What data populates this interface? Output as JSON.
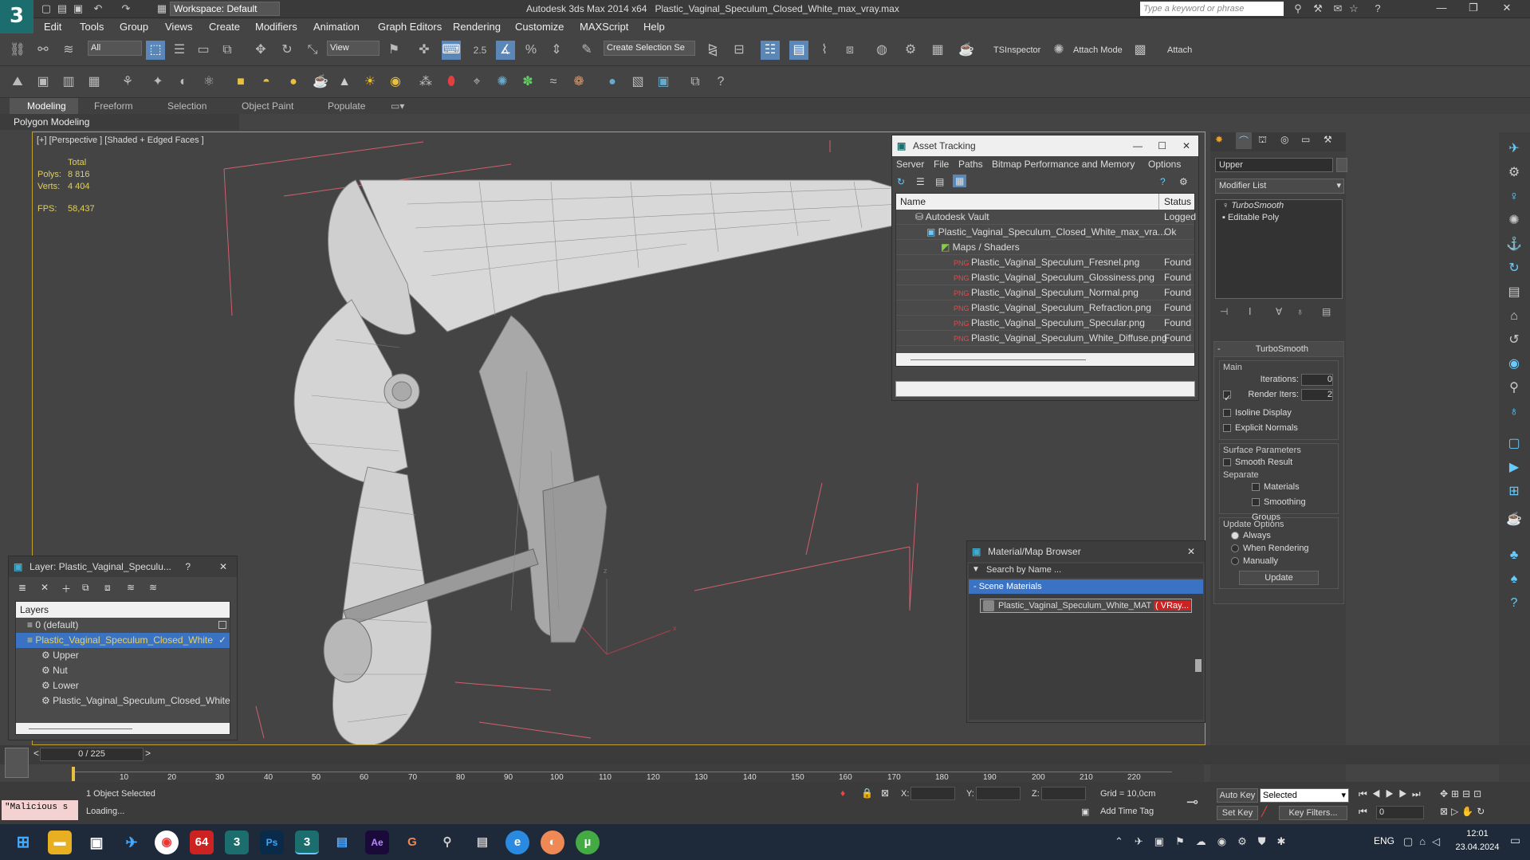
{
  "app": {
    "title": "Autodesk 3ds Max 2014 x64",
    "file": "Plastic_Vaginal_Speculum_Closed_White_max_vray.max",
    "workspace": "Workspace: Default",
    "search_placeholder": "Type a keyword or phrase"
  },
  "menu": [
    "Edit",
    "Tools",
    "Group",
    "Views",
    "Create",
    "Modifiers",
    "Animation",
    "Graph Editors",
    "Rendering",
    "Customize",
    "MAXScript",
    "Help"
  ],
  "toolbar": {
    "filter": "All",
    "refcoord": "View",
    "spinner": "2.5",
    "selection_set": "Create Selection Se",
    "tsinspector": "TSInspector",
    "attach_mode": "Attach Mode",
    "attach": "Attach"
  },
  "ribbon": {
    "tabs": [
      "Modeling",
      "Freeform",
      "Selection",
      "Object Paint",
      "Populate"
    ],
    "sub": "Polygon Modeling"
  },
  "viewport": {
    "label": "[+] [Perspective ] [Shaded + Edged Faces ]",
    "total_label": "Total",
    "polys_label": "Polys:",
    "polys": "8 816",
    "verts_label": "Verts:",
    "verts": "4 404",
    "fps_label": "FPS:",
    "fps": "58,437",
    "axis_z": "z",
    "axis_x": "x"
  },
  "asset_tracking": {
    "title": "Asset Tracking",
    "menu": [
      "Server",
      "File",
      "Paths",
      "Bitmap Performance and Memory",
      "Options"
    ],
    "col_name": "Name",
    "col_status": "Status",
    "rows": [
      {
        "name": "Autodesk Vault",
        "status": "Logged"
      },
      {
        "name": "Plastic_Vaginal_Speculum_Closed_White_max_vra...",
        "status": "Ok"
      },
      {
        "name": "Maps / Shaders",
        "status": ""
      },
      {
        "name": "Plastic_Vaginal_Speculum_Fresnel.png",
        "status": "Found"
      },
      {
        "name": "Plastic_Vaginal_Speculum_Glossiness.png",
        "status": "Found"
      },
      {
        "name": "Plastic_Vaginal_Speculum_Normal.png",
        "status": "Found"
      },
      {
        "name": "Plastic_Vaginal_Speculum_Refraction.png",
        "status": "Found"
      },
      {
        "name": "Plastic_Vaginal_Speculum_Specular.png",
        "status": "Found"
      },
      {
        "name": "Plastic_Vaginal_Speculum_White_Diffuse.png",
        "status": "Found"
      }
    ]
  },
  "layer": {
    "title": "Layer: Plastic_Vaginal_Speculu...",
    "help": "?",
    "header": "Layers",
    "items": [
      "0 (default)",
      "Plastic_Vaginal_Speculum_Closed_White",
      "Upper",
      "Nut",
      "Lower",
      "Plastic_Vaginal_Speculum_Closed_White"
    ]
  },
  "material": {
    "title": "Material/Map Browser",
    "search_placeholder": "Search by Name ...",
    "group": "- Scene Materials",
    "item": "Plastic_Vaginal_Speculum_White_MAT",
    "item_tag": "( VRay..."
  },
  "command": {
    "object_name": "Upper",
    "modifier_list": "Modifier List",
    "stack": [
      "TurboSmooth",
      "Editable Poly"
    ],
    "rollout": "TurboSmooth",
    "main": "Main",
    "iterations_label": "Iterations:",
    "iterations": "0",
    "render_iters_label": "Render Iters:",
    "render_iters": "2",
    "isoline": "Isoline Display",
    "explicit": "Explicit Normals",
    "surface": "Surface Parameters",
    "smooth_result": "Smooth Result",
    "separate": "Separate",
    "materials": "Materials",
    "smoothing_groups": "Smoothing Groups",
    "update_options": "Update Options",
    "always": "Always",
    "when_rendering": "When Rendering",
    "manually": "Manually",
    "update": "Update"
  },
  "timeline": {
    "frame": "0 / 225",
    "ticks": [
      "10",
      "20",
      "30",
      "40",
      "50",
      "60",
      "70",
      "80",
      "90",
      "100",
      "110",
      "120",
      "130",
      "140",
      "150",
      "160",
      "170",
      "180",
      "190",
      "200",
      "210",
      "220"
    ]
  },
  "status": {
    "script": "\"Malicious s",
    "selected": "1 Object Selected",
    "loading": "Loading...",
    "x": "X:",
    "y": "Y:",
    "z": "Z:",
    "grid": "Grid = 10,0cm",
    "add_time_tag": "Add Time Tag",
    "auto_key": "Auto Key",
    "set_key": "Set Key",
    "selected_drop": "Selected",
    "key_filters": "Key Filters...",
    "frame_field": "0"
  },
  "taskbar": {
    "lang": "ENG",
    "time": "12:01",
    "date": "23.04.2024",
    "badge64": "64"
  }
}
